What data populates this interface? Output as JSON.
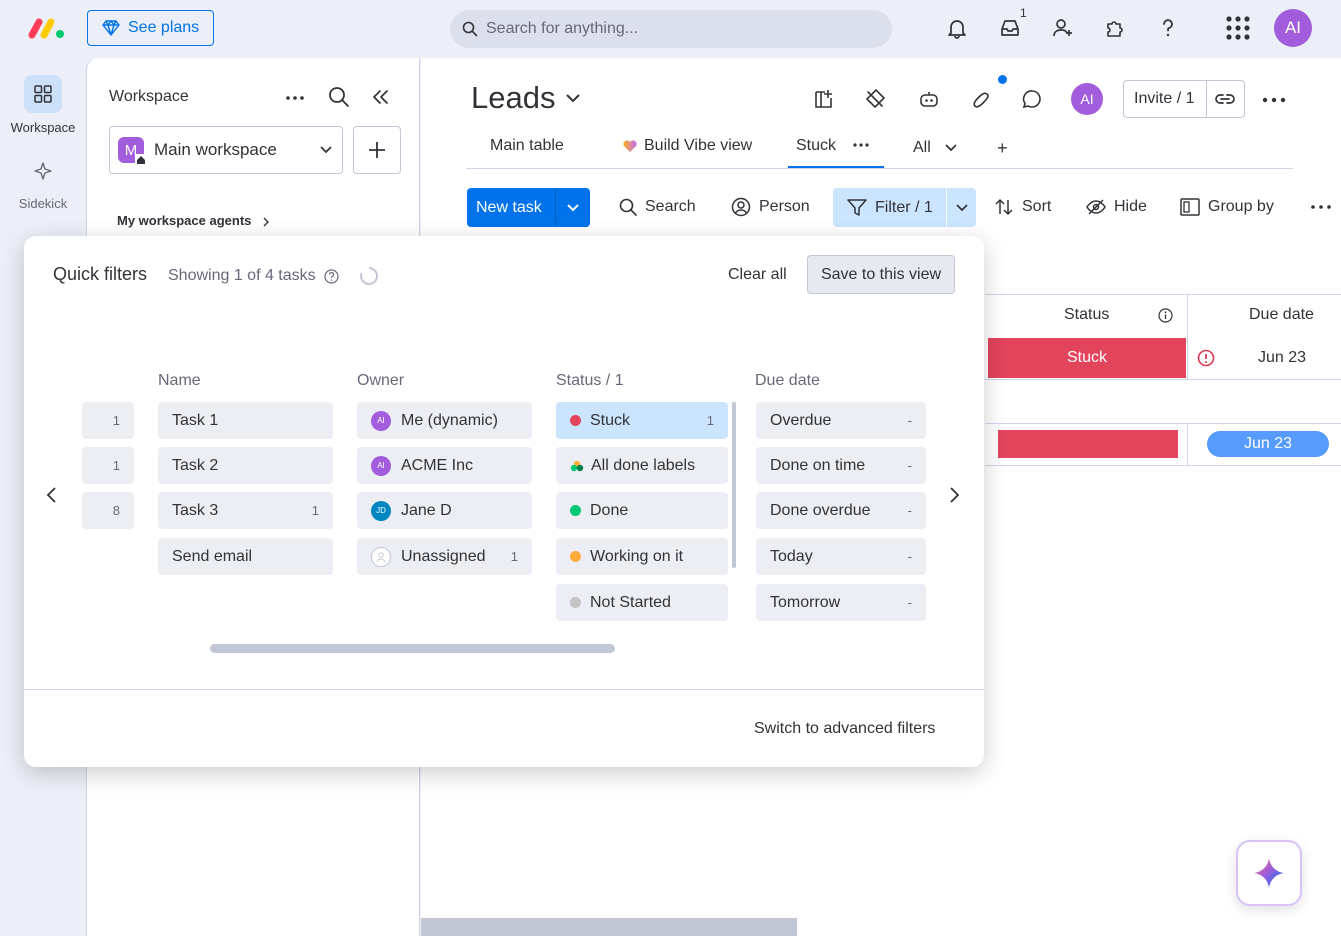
{
  "topbar": {
    "see_plans": "See plans",
    "search_placeholder": "Search for anything...",
    "inbox_count": "1",
    "avatar_initials": "AI",
    "icons": [
      "bell-icon",
      "inbox-icon",
      "invite-people-icon",
      "apps-puzzle-icon",
      "help-icon",
      "grid-menu-icon"
    ]
  },
  "rail": {
    "items": [
      {
        "label": "Workspace",
        "icon": "grid-icon"
      },
      {
        "label": "Sidekick",
        "icon": "sparkle-icon"
      }
    ]
  },
  "workspace_panel": {
    "title": "Workspace",
    "selected_workspace": "Main workspace",
    "workspace_letter": "M",
    "agents_link": "My workspace agents"
  },
  "board": {
    "title": "Leads",
    "avatar_initials": "AI",
    "invite_label": "Invite / 1",
    "tabs": [
      {
        "label": "Main table"
      },
      {
        "label": "Build Vibe view"
      },
      {
        "label": "Stuck"
      },
      {
        "label": "All"
      },
      {
        "label": "+"
      }
    ],
    "toolbar": {
      "new_task": "New task",
      "search": "Search",
      "person": "Person",
      "filter": "Filter / 1",
      "sort": "Sort",
      "hide": "Hide",
      "group_by": "Group by"
    },
    "columns": {
      "status": "Status",
      "due_date": "Due date"
    },
    "rows": [
      {
        "status": "Stuck",
        "due": "Jun 23"
      },
      {
        "status": "",
        "due": "Jun 23"
      }
    ]
  },
  "quick_filters": {
    "title": "Quick filters",
    "showing": "Showing 1 of 4 tasks",
    "clear_all": "Clear all",
    "save_view": "Save to this view",
    "advanced": "Switch to advanced filters",
    "partial_column_counts": [
      "1",
      "1",
      "8"
    ],
    "columns": [
      {
        "header": "Name",
        "items": [
          {
            "label": "Task 1",
            "count": ""
          },
          {
            "label": "Task 2",
            "count": ""
          },
          {
            "label": "Task 3",
            "count": "1"
          },
          {
            "label": "Send email",
            "count": ""
          }
        ]
      },
      {
        "header": "Owner",
        "items": [
          {
            "label": "Me (dynamic)",
            "avatar": "AI",
            "color": "#a25ddc",
            "count": ""
          },
          {
            "label": "ACME Inc",
            "avatar": "AI",
            "color": "#a25ddc",
            "count": ""
          },
          {
            "label": "Jane D",
            "avatar": "JD",
            "color": "#0086c0",
            "count": ""
          },
          {
            "label": "Unassigned",
            "avatar": "",
            "color": "#ffffff",
            "count": "1"
          }
        ]
      },
      {
        "header": "Status / 1",
        "items": [
          {
            "label": "Stuck",
            "color": "#e2445c",
            "count": "1",
            "selected": true
          },
          {
            "label": "All done labels",
            "color": "multi",
            "count": ""
          },
          {
            "label": "Done",
            "color": "#00c875",
            "count": ""
          },
          {
            "label": "Working on it",
            "color": "#fdab3d",
            "count": ""
          },
          {
            "label": "Not Started",
            "color": "#c4c4c4",
            "count": ""
          }
        ]
      },
      {
        "header": "Due date",
        "items": [
          {
            "label": "Overdue",
            "count": "-"
          },
          {
            "label": "Done on time",
            "count": "-"
          },
          {
            "label": "Done overdue",
            "count": "-"
          },
          {
            "label": "Today",
            "count": "-"
          },
          {
            "label": "Tomorrow",
            "count": "-"
          }
        ]
      }
    ]
  },
  "colors": {
    "primary": "#0073ea",
    "stuck": "#e2445c",
    "due_pill": "#579bfc",
    "avatar": "#a25ddc"
  }
}
